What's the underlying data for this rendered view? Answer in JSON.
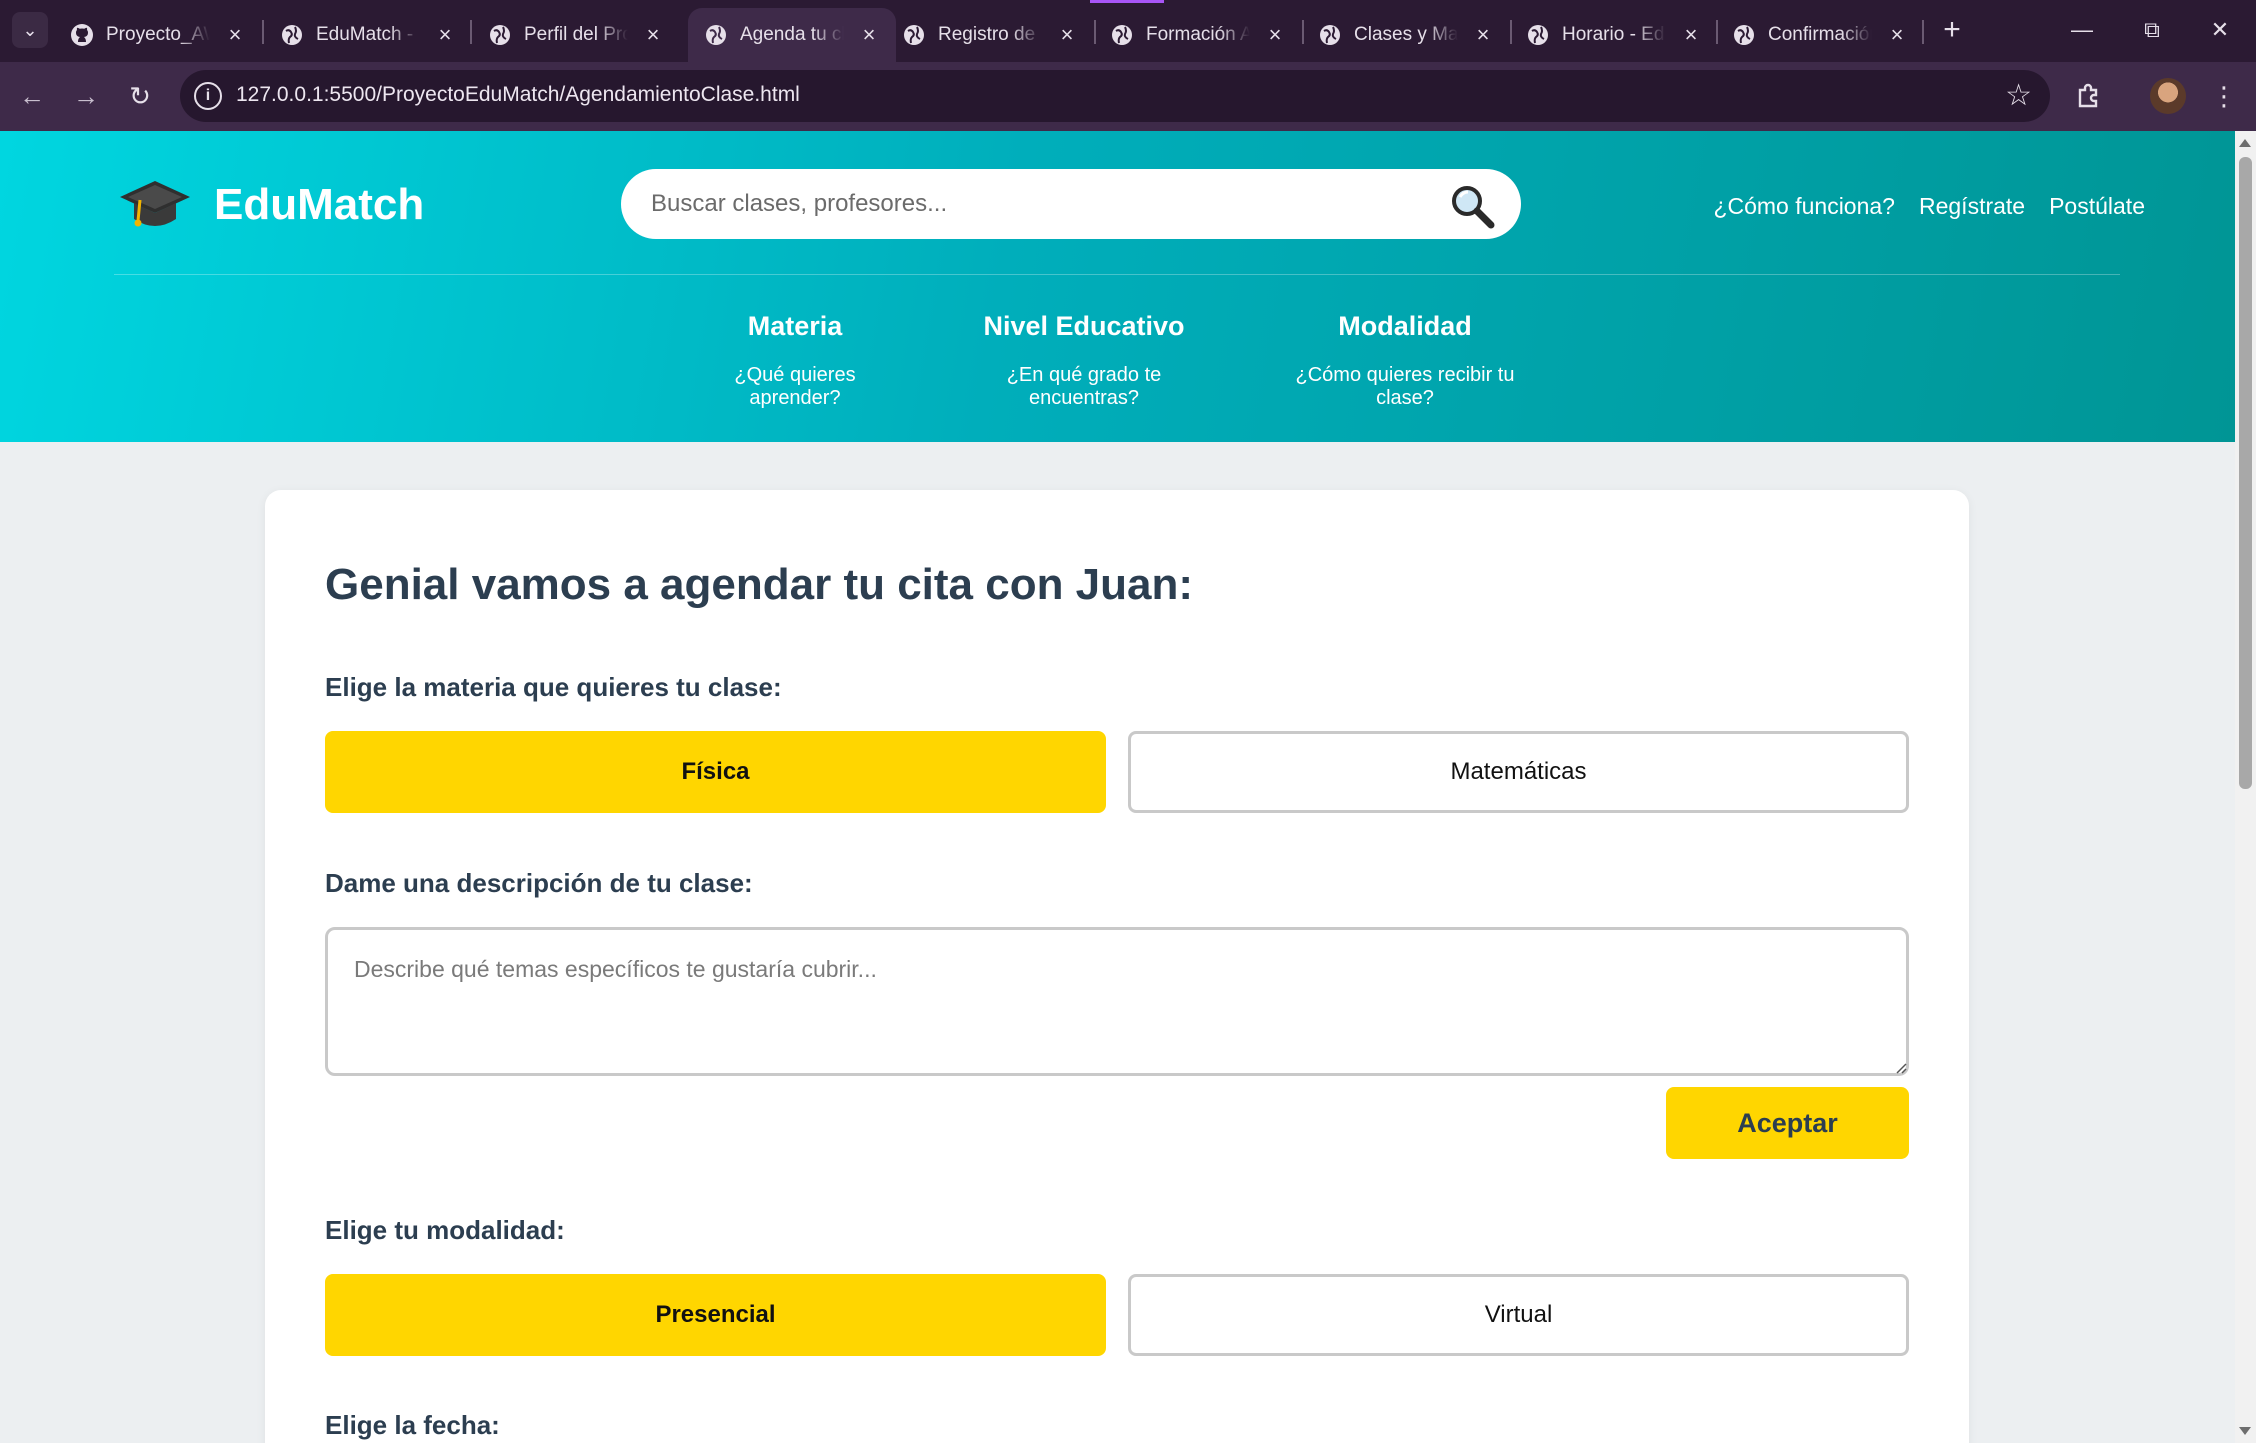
{
  "browser": {
    "tabs": [
      {
        "title": "Proyecto_AW",
        "icon": "github-icon"
      },
      {
        "title": "EduMatch - P",
        "icon": "globe-icon"
      },
      {
        "title": "Perfil del Pro",
        "icon": "globe-icon"
      },
      {
        "title": "Agenda tu cl",
        "icon": "globe-icon",
        "active": true
      },
      {
        "title": "Registro de P",
        "icon": "globe-icon"
      },
      {
        "title": "Formación A",
        "icon": "globe-icon"
      },
      {
        "title": "Clases y Mat",
        "icon": "globe-icon"
      },
      {
        "title": "Horario - Edu",
        "icon": "globe-icon"
      },
      {
        "title": "Confirmación",
        "icon": "globe-icon"
      }
    ],
    "url": "127.0.0.1:5500/ProyectoEduMatch/AgendamientoClase.html"
  },
  "header": {
    "brand": "EduMatch",
    "search_placeholder": "Buscar clases, profesores...",
    "links": [
      "¿Cómo funciona?",
      "Regístrate",
      "Postúlate"
    ],
    "filters": [
      {
        "title": "Materia",
        "subtitle": "¿Qué quieres aprender?"
      },
      {
        "title": "Nivel Educativo",
        "subtitle": "¿En qué grado te encuentras?"
      },
      {
        "title": "Modalidad",
        "subtitle": "¿Cómo quieres recibir tu clase?"
      }
    ]
  },
  "form": {
    "title": "Genial vamos a agendar tu cita con Juan:",
    "subject_label": "Elige la materia que quieres tu clase:",
    "subjects": [
      {
        "label": "Física",
        "selected": true
      },
      {
        "label": "Matemáticas",
        "selected": false
      }
    ],
    "description_label": "Dame una descripción de tu clase:",
    "description_placeholder": "Describe qué temas específicos te gustaría cubrir...",
    "accept_label": "Aceptar",
    "modality_label": "Elige tu modalidad:",
    "modalities": [
      {
        "label": "Presencial",
        "selected": true
      },
      {
        "label": "Virtual",
        "selected": false
      }
    ],
    "date_label": "Elige la fecha:"
  },
  "colors": {
    "accent": "#ffd600",
    "header_start": "#00d6e0",
    "header_end": "#009595",
    "text_dark": "#2c3e50",
    "chrome_bg": "#2b1a33"
  }
}
